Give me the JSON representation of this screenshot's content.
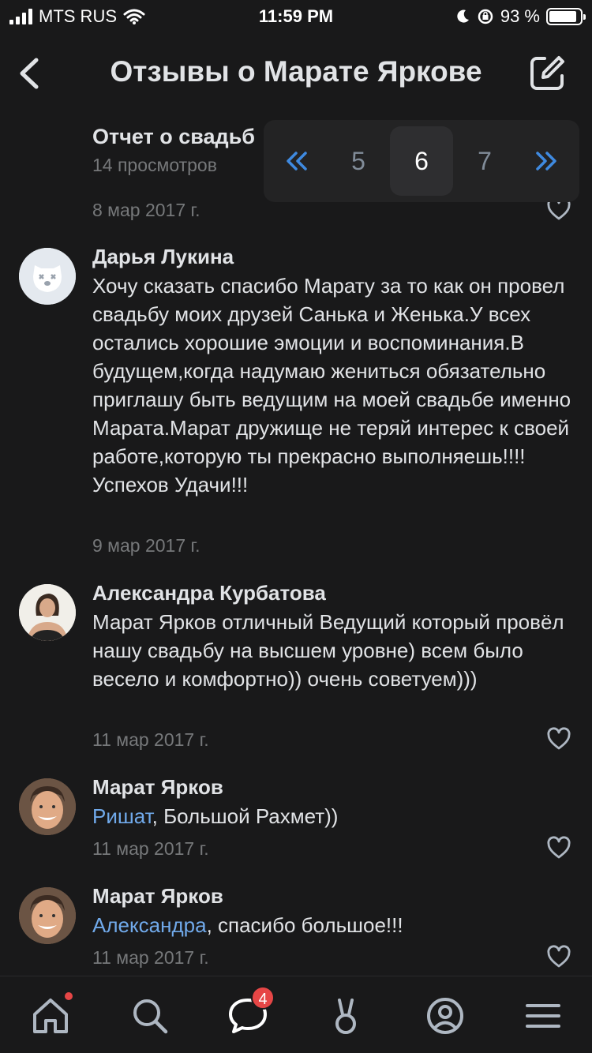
{
  "status_bar": {
    "carrier": "MTS RUS",
    "time": "11:59 PM",
    "battery": "93 %"
  },
  "header": {
    "title": "Отзывы о Марате Яркове"
  },
  "top_post": {
    "title": "Отчет о свадьб",
    "views": "14 просмотров",
    "date": "8 мар 2017 г."
  },
  "pagination": {
    "prev": "«",
    "pages": [
      "5",
      "6",
      "7"
    ],
    "current": "6",
    "next": "»"
  },
  "comments": [
    {
      "author": "Дарья Лукина",
      "text": "Хочу сказать спасибо Марату  за то как он провел свадьбу моих друзей Санька и Женька.У всех остались хорошие эмоции и воспоминания.В будущем,когда надумаю жениться обязательно приглашу быть ведущим на моей свадьбе именно Марата.Марат дружище не теряй интерес к своей работе,которую ты прекрасно выполняешь!!!!Успехов Удачи!!!",
      "date": "9 мар 2017 г."
    },
    {
      "author": "Александра Курбатова",
      "text": "Марат Ярков отличный Ведущий который провёл нашу свадьбу на высшем уровне) всем было весело и комфортно)) очень советуем)))",
      "date": "11 мар 2017 г."
    },
    {
      "author": "Марат Ярков",
      "mention": "Ришат",
      "text": ", Большой Рахмет))",
      "date": "11 мар 2017 г."
    },
    {
      "author": "Марат Ярков",
      "mention": "Александра",
      "text": ", спасибо большое!!!",
      "date": "11 мар 2017 г."
    }
  ],
  "tabbar": {
    "messages_badge": "4",
    "icons": [
      "home-icon",
      "search-icon",
      "messages-icon",
      "clips-icon",
      "profile-icon",
      "menu-icon"
    ]
  },
  "colors": {
    "background": "#19191a",
    "text": "#e1e3e6",
    "secondary": "#76787a",
    "link": "#71aaeb",
    "badge": "#e64646"
  }
}
